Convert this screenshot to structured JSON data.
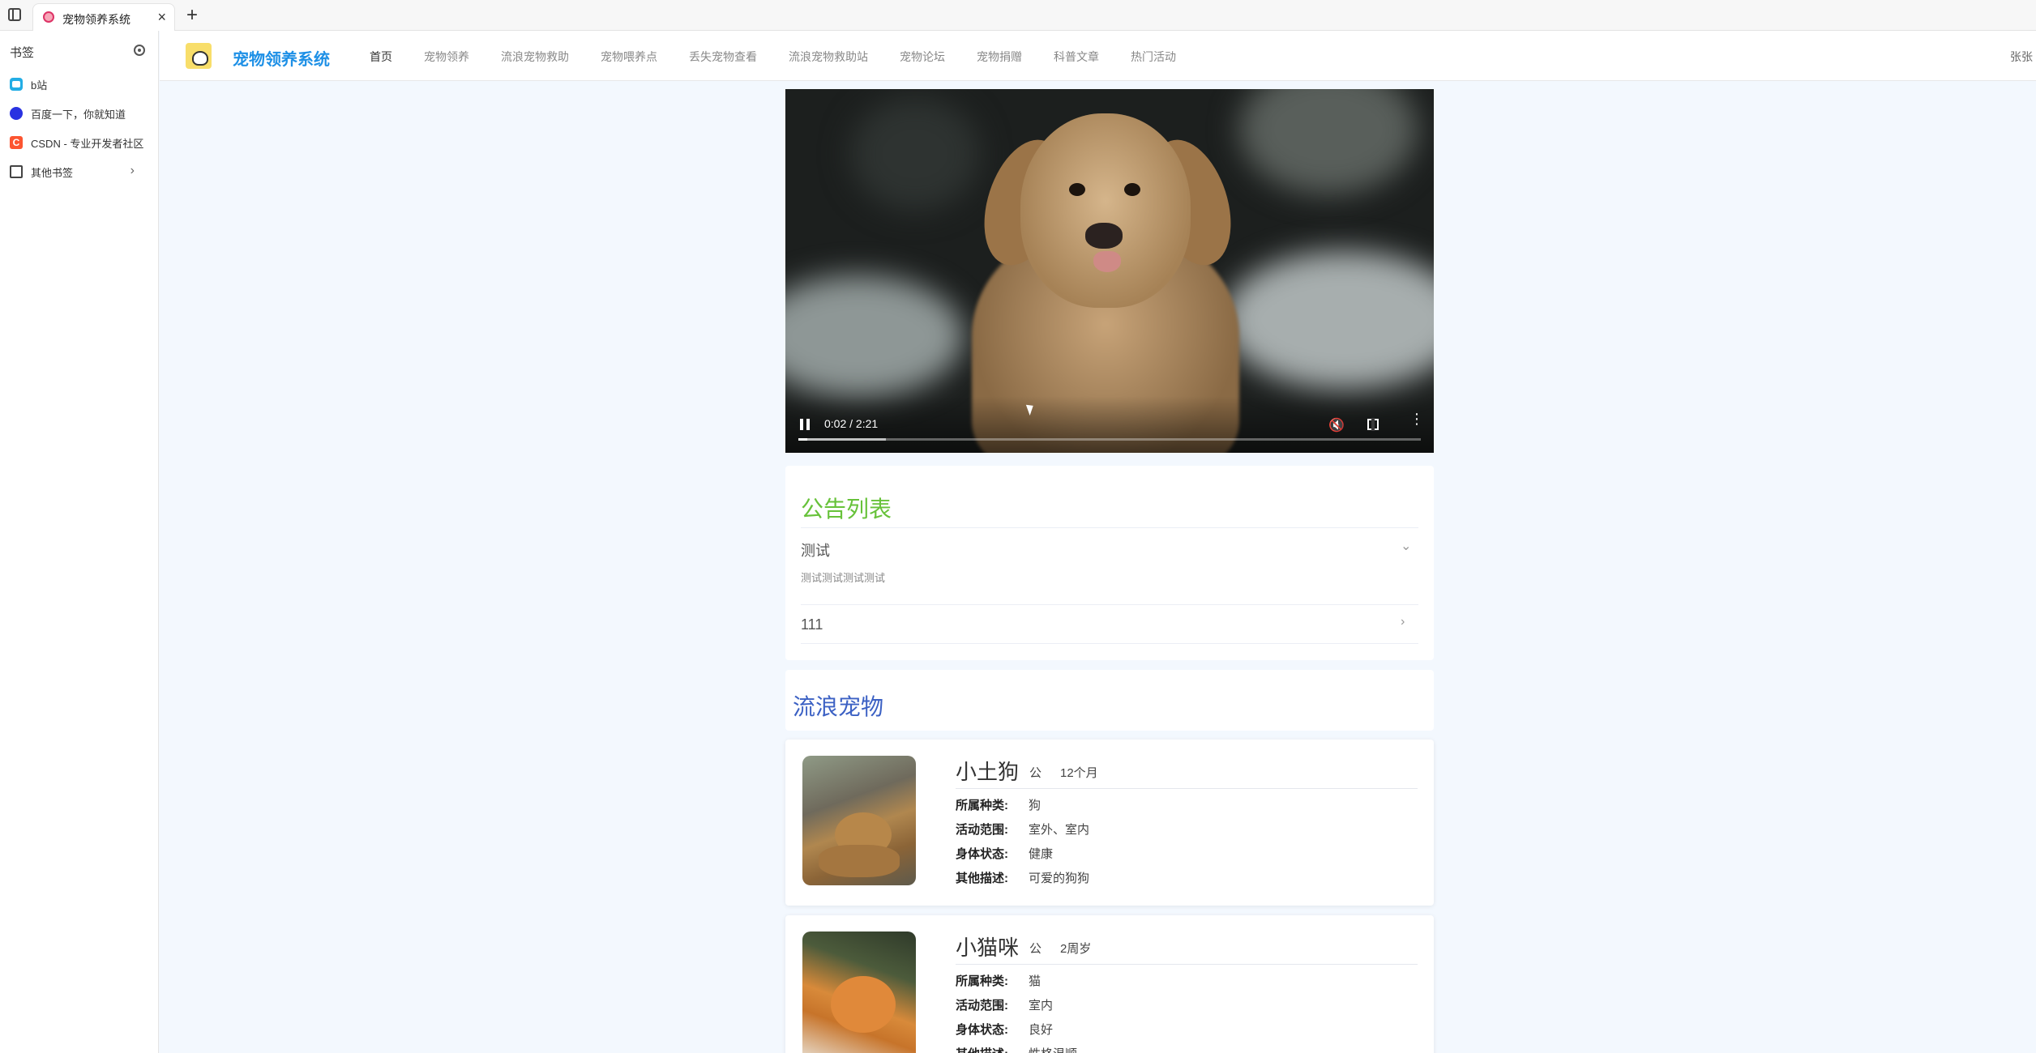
{
  "browser": {
    "tab_title": "宠物领养系统",
    "tab_close": "×",
    "new_tab": "+"
  },
  "bookmarks": {
    "header": "书签",
    "items": [
      {
        "label": "b站",
        "icon": "bilibili-icon"
      },
      {
        "label": "百度一下，你就知道",
        "icon": "baidu-icon"
      },
      {
        "label": "CSDN - 专业开发者社区",
        "icon": "csdn-icon",
        "glyph": "C"
      },
      {
        "label": "其他书签",
        "icon": "folder-icon",
        "chevron": "›"
      }
    ]
  },
  "site": {
    "name": "宠物领养系统",
    "nav": [
      "首页",
      "宠物领养",
      "流浪宠物救助",
      "宠物喂养点",
      "丢失宠物查看",
      "流浪宠物救助站",
      "宠物论坛",
      "宠物捐赠",
      "科普文章",
      "热门活动"
    ],
    "active_nav": "首页",
    "user": "张张"
  },
  "video": {
    "time": "0:02 / 2:21",
    "played_fraction": 0.014,
    "buffered_fraction": 0.14,
    "muted": true,
    "mute_glyph": "🔇",
    "more_glyph": "⋮"
  },
  "notices": {
    "title": "公告列表",
    "items": [
      {
        "title": "测试",
        "body": "测试测试测试测试",
        "expanded": true,
        "chevron": "⌄"
      },
      {
        "title": "111",
        "body": "",
        "expanded": false,
        "chevron": "›"
      }
    ]
  },
  "stray": {
    "title": "流浪宠物",
    "labels": {
      "type": "所属种类:",
      "range": "活动范围:",
      "health": "身体状态:",
      "desc": "其他描述:"
    },
    "pets": [
      {
        "name": "小土狗",
        "sex": "公",
        "age": "12个月",
        "type": "狗",
        "range": "室外、室内",
        "health": "健康",
        "desc": "可爱的狗狗"
      },
      {
        "name": "小猫咪",
        "sex": "公",
        "age": "2周岁",
        "type": "猫",
        "range": "室内",
        "health": "良好",
        "desc": "性格温顺"
      }
    ]
  }
}
